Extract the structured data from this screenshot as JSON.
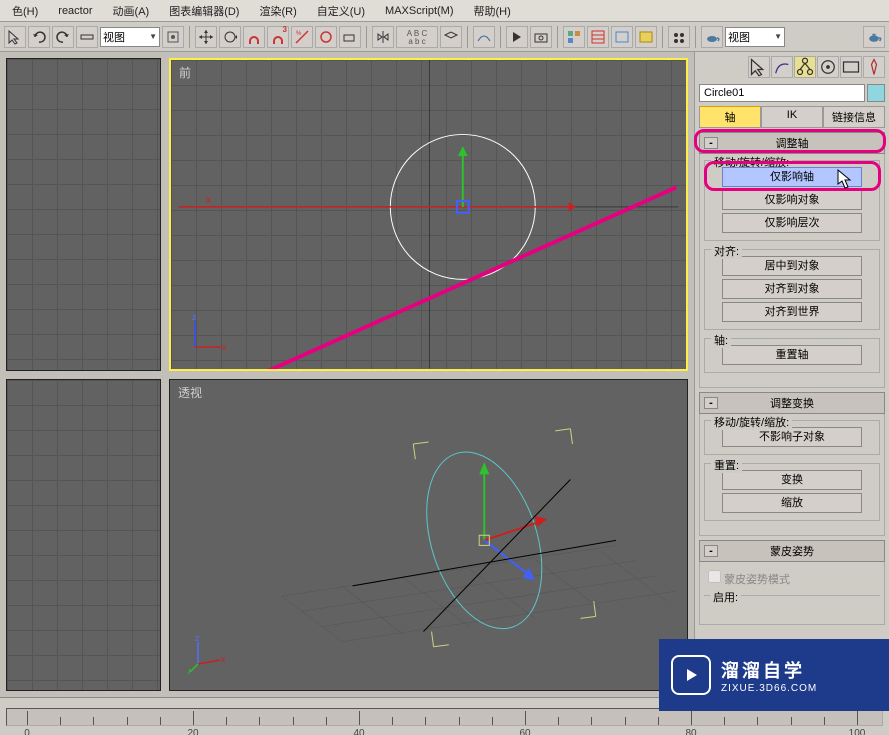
{
  "menu": {
    "items": [
      "色(H)",
      "reactor",
      "动画(A)",
      "图表编辑器(D)",
      "渲染(R)",
      "自定义(U)",
      "MAXScript(M)",
      "帮助(H)"
    ]
  },
  "toolbar": {
    "dd1": "视图",
    "dd2": "视图"
  },
  "viewports": {
    "top_right": "前",
    "bottom_right": "透视",
    "axis_x": "x",
    "axis_y": "y",
    "axis_z": "z"
  },
  "panel": {
    "object_name": "Circle01",
    "tabs": {
      "axis": "轴",
      "ik": "IK",
      "link": "链接信息"
    },
    "rollout1": {
      "title": "调整轴"
    },
    "group1": {
      "label": "移动/旋转/缩放:",
      "b1": "仅影响轴",
      "b2": "仅影响对象",
      "b3": "仅影响层次"
    },
    "group2": {
      "label": "对齐:",
      "b1": "居中到对象",
      "b2": "对齐到对象",
      "b3": "对齐到世界"
    },
    "group3": {
      "label": "轴:",
      "b1": "重置轴"
    },
    "rollout2": {
      "title": "调整变换"
    },
    "group4": {
      "label": "移动/旋转/缩放:",
      "b1": "不影响子对象"
    },
    "group5": {
      "label": "重置:",
      "b1": "变换",
      "b2": "缩放"
    },
    "rollout3": {
      "title": "蒙皮姿势"
    },
    "group6": {
      "chk": "蒙皮姿势模式",
      "enable": "启用:"
    }
  },
  "watermark": {
    "t1": "溜溜自学",
    "t2": "ZIXUE.3D66.COM"
  },
  "ruler": {
    "ticks": [
      "0",
      "20",
      "40",
      "60",
      "80",
      "100"
    ]
  }
}
